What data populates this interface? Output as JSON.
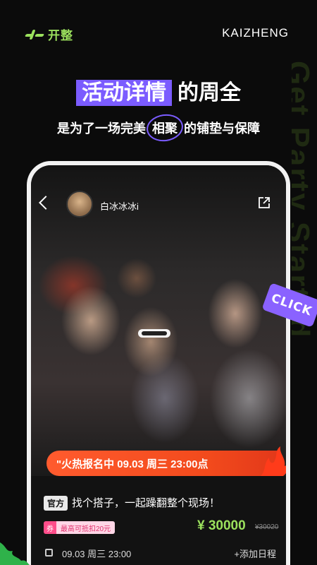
{
  "brand": {
    "name": "开整",
    "english": "KAIZHENG",
    "color": "#9be15d"
  },
  "slogan_vertical": "Get Party Started",
  "headline": {
    "highlight": "活动详情",
    "rest": "的周全"
  },
  "subline": {
    "before": "是为了一场完美",
    "circled": "相聚",
    "after": "的铺垫与保障"
  },
  "post": {
    "username": "白冰冰冰i",
    "banner": "\"火热报名中  09.03 周三 23:00点",
    "tag": "官方",
    "title": "找个搭子，一起躁翻整个现场！",
    "coupon_badge": "券",
    "coupon_text": "最高可抵扣20元",
    "price": "¥ 30000",
    "original_price": "¥30020",
    "date": "09.03  周三  23:00",
    "add_calendar": "+添加日程"
  },
  "sticker": "CLICK",
  "colors": {
    "accent_purple": "#7b5cff",
    "accent_green": "#9be15d",
    "banner_orange": "#ff5b2e"
  }
}
